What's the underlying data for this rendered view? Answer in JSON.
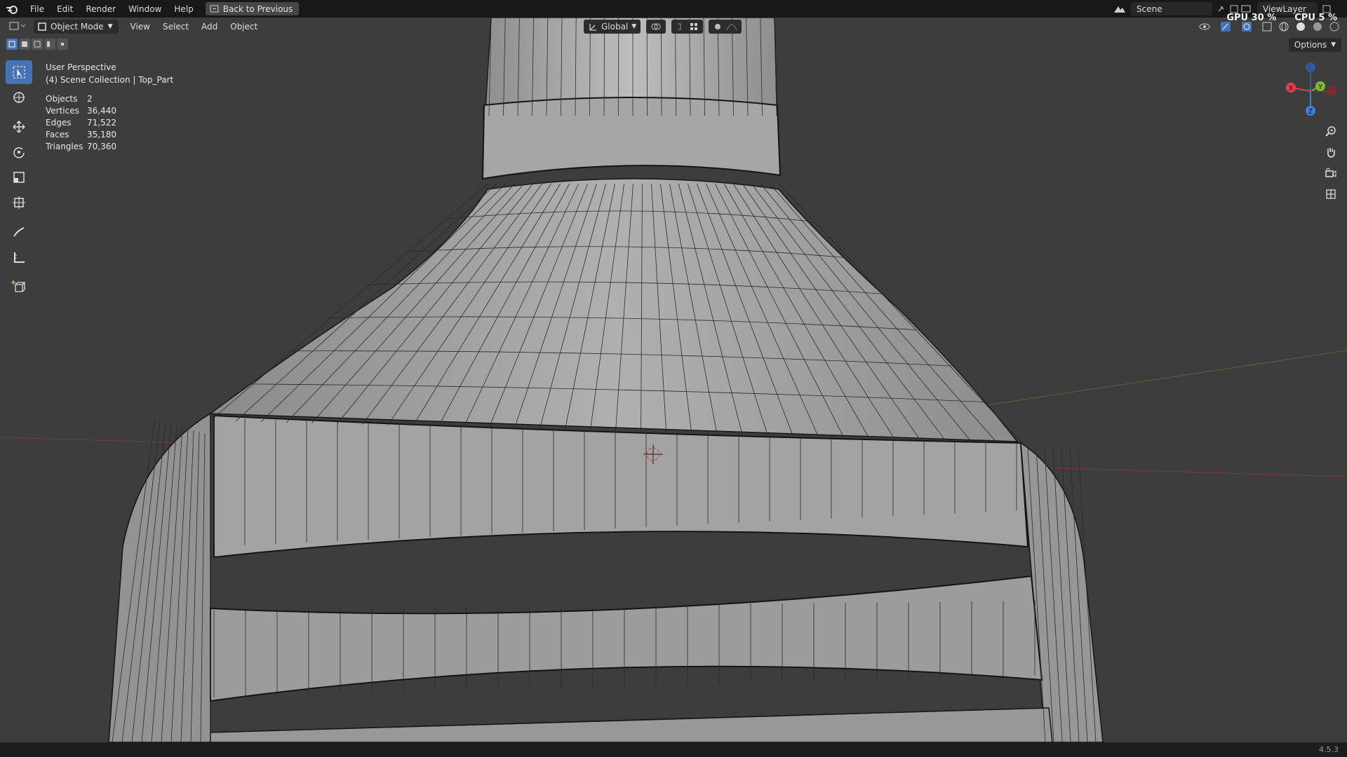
{
  "menubar": {
    "items": [
      "File",
      "Edit",
      "Render",
      "Window",
      "Help"
    ],
    "back_button": "Back to Previous",
    "scene": "Scene",
    "view_layer": "ViewLayer",
    "gpu": "GPU 30 %",
    "cpu": "CPU 5 %"
  },
  "viewport_header": {
    "mode": "Object Mode",
    "menus": [
      "View",
      "Select",
      "Add",
      "Object"
    ],
    "transform_orientation": "Global",
    "options_label": "Options"
  },
  "overlay": {
    "view_name": "User Perspective",
    "collection": "(4) Scene Collection | Top_Part",
    "stats": [
      {
        "label": "Objects",
        "value": "2"
      },
      {
        "label": "Vertices",
        "value": "36,440"
      },
      {
        "label": "Edges",
        "value": "71,522"
      },
      {
        "label": "Faces",
        "value": "35,180"
      },
      {
        "label": "Triangles",
        "value": "70,360"
      }
    ]
  },
  "gizmo": {
    "x": "X",
    "y": "Y",
    "z": "Z"
  },
  "toolbar": [
    "select-box",
    "cursor",
    "move",
    "rotate",
    "scale",
    "transform",
    "annotate",
    "measure",
    "add-cube"
  ],
  "status": {
    "version": "4.5.3"
  },
  "colors": {
    "accent": "#4772b3",
    "x_axis": "#e2404c",
    "y_axis": "#7fb937",
    "z_axis": "#3d82d9"
  }
}
